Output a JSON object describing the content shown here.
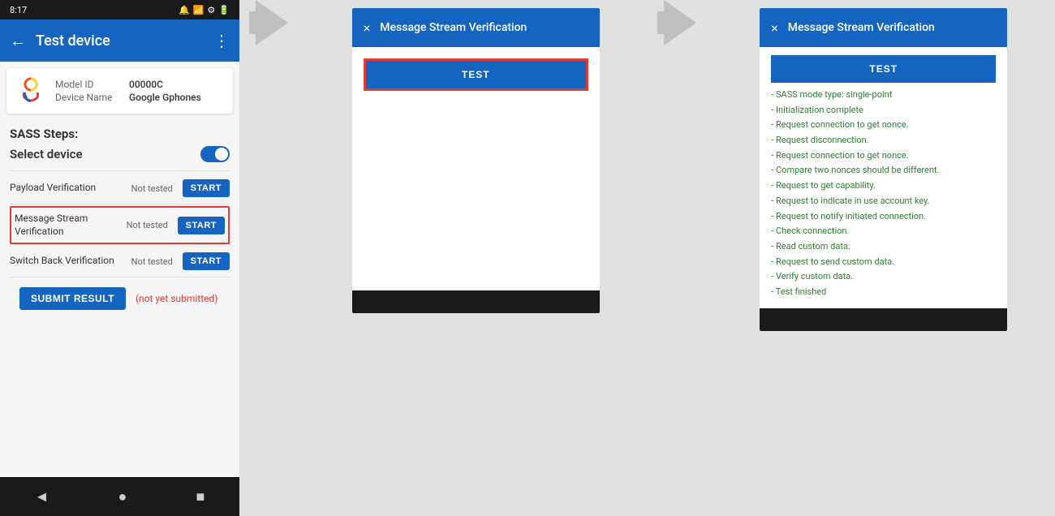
{
  "statusBar": {
    "time": "8:17",
    "icons": [
      "notification",
      "sim",
      "wifi-settings",
      "settings-icon",
      "battery"
    ]
  },
  "phone": {
    "toolbar": {
      "title": "Test device",
      "backLabel": "←",
      "moreLabel": "⋮"
    },
    "device": {
      "modelIdLabel": "Model ID",
      "modelIdValue": "00000C",
      "deviceNameLabel": "Device Name",
      "deviceNameValue": "Google Gphones"
    },
    "sassTitle": "SASS Steps:",
    "selectDeviceLabel": "Select device",
    "steps": [
      {
        "name": "Payload Verification",
        "status": "Not tested",
        "btn": "START"
      },
      {
        "name": "Message Stream\nVerification",
        "status": "Not tested",
        "btn": "START",
        "highlighted": true
      },
      {
        "name": "Switch Back Verification",
        "status": "Not tested",
        "btn": "START"
      }
    ],
    "submitBtn": "SUBMIT RESULT",
    "notSubmitted": "(not yet submitted)"
  },
  "dialog1": {
    "title": "Message Stream Verification",
    "closeIcon": "×",
    "testBtn": "TEST"
  },
  "dialog2": {
    "title": "Message Stream Verification",
    "closeIcon": "×",
    "testBtn": "TEST",
    "results": [
      "- SASS mode type: single-point",
      "- Initialization complete",
      "- Request connection to get nonce.",
      "- Request disconnection.",
      "- Request connection to get nonce.",
      "- Compare two nonces should be different.",
      "- Request to get capability.",
      "- Request to indicate in use account key.",
      "- Request to notify initiated connection.",
      "- Check connection.",
      "- Read custom data.",
      "- Request to send custom data.",
      "- Verify custom data.",
      "- Test finished"
    ]
  }
}
